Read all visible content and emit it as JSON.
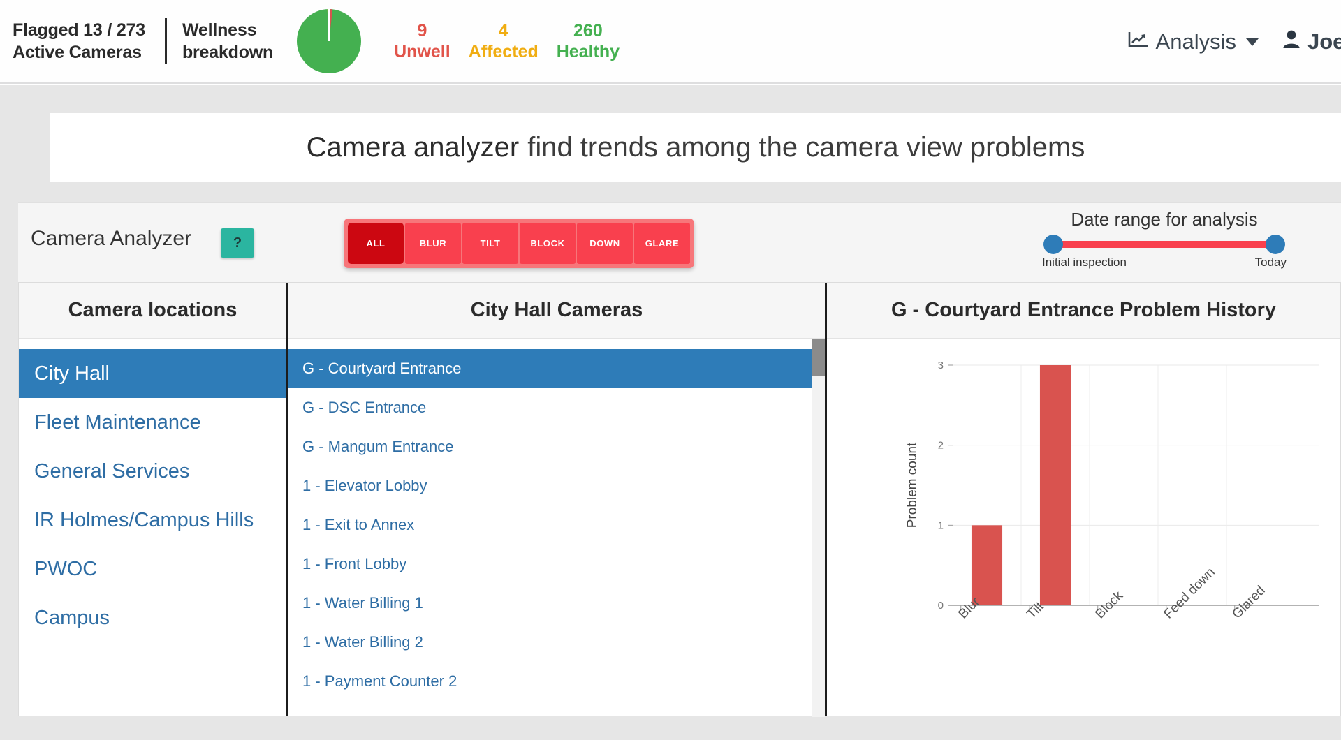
{
  "header": {
    "flagged_line1": "Flagged 13 / 273",
    "flagged_line2": "Active Cameras",
    "wellness_line1": "Wellness",
    "wellness_line2": "breakdown",
    "stats": [
      {
        "num": "9",
        "label": "Unwell",
        "color": "#e1544a"
      },
      {
        "num": "4",
        "label": "Affected",
        "color": "#f0ad12"
      },
      {
        "num": "260",
        "label": "Healthy",
        "color": "#44b050"
      }
    ],
    "nav_analysis": "Analysis",
    "nav_user": "Joel"
  },
  "banner": {
    "title_bold": "Camera analyzer",
    "title_rest": "find trends among the camera view problems"
  },
  "controls": {
    "analyzer_label": "Camera Analyzer",
    "help_label": "?",
    "filters": [
      {
        "label": "ALL",
        "active": true
      },
      {
        "label": "BLUR",
        "active": false
      },
      {
        "label": "TILT",
        "active": false
      },
      {
        "label": "BLOCK",
        "active": false
      },
      {
        "label": "DOWN",
        "active": false
      },
      {
        "label": "GLARE",
        "active": false
      }
    ],
    "date_range": {
      "title": "Date range for analysis",
      "start_label": "Initial inspection",
      "end_label": "Today"
    }
  },
  "panels": {
    "locations_header": "Camera locations",
    "cameras_header": "City Hall Cameras",
    "chart_header": "G - Courtyard Entrance Problem History",
    "locations": [
      {
        "label": "City Hall",
        "selected": true
      },
      {
        "label": "Fleet Maintenance",
        "selected": false
      },
      {
        "label": "General Services",
        "selected": false
      },
      {
        "label": "IR Holmes/Campus Hills",
        "selected": false
      },
      {
        "label": "PWOC",
        "selected": false
      },
      {
        "label": "Campus",
        "selected": false
      }
    ],
    "cameras": [
      {
        "label": "G - Courtyard Entrance",
        "selected": true
      },
      {
        "label": "G - DSC Entrance",
        "selected": false
      },
      {
        "label": "G - Mangum Entrance",
        "selected": false
      },
      {
        "label": "1 - Elevator Lobby",
        "selected": false
      },
      {
        "label": "1 - Exit to Annex",
        "selected": false
      },
      {
        "label": "1 - Front Lobby",
        "selected": false
      },
      {
        "label": "1 - Water Billing 1",
        "selected": false
      },
      {
        "label": "1 - Water Billing 2",
        "selected": false
      },
      {
        "label": "1 - Payment Counter 2",
        "selected": false
      }
    ]
  },
  "chart_data": {
    "type": "bar",
    "title": "G - Courtyard Entrance Problem History",
    "categories": [
      "Blur",
      "Tilt",
      "Block",
      "Feed down",
      "Glared"
    ],
    "values": [
      1,
      3,
      0,
      0,
      0
    ],
    "xlabel": "",
    "ylabel": "Problem count",
    "ylim": [
      0,
      3
    ],
    "yticks": [
      0,
      1,
      2,
      3
    ],
    "grid": true,
    "bar_color": "#d9534f",
    "legend": "none",
    "xtick_rotation": -45
  },
  "colors": {
    "accent_blue": "#2e7cb8",
    "red": "#f9404e",
    "red_active": "#cc0711",
    "teal": "#2bb5a0",
    "green": "#44b050",
    "orange": "#f0ad12"
  }
}
